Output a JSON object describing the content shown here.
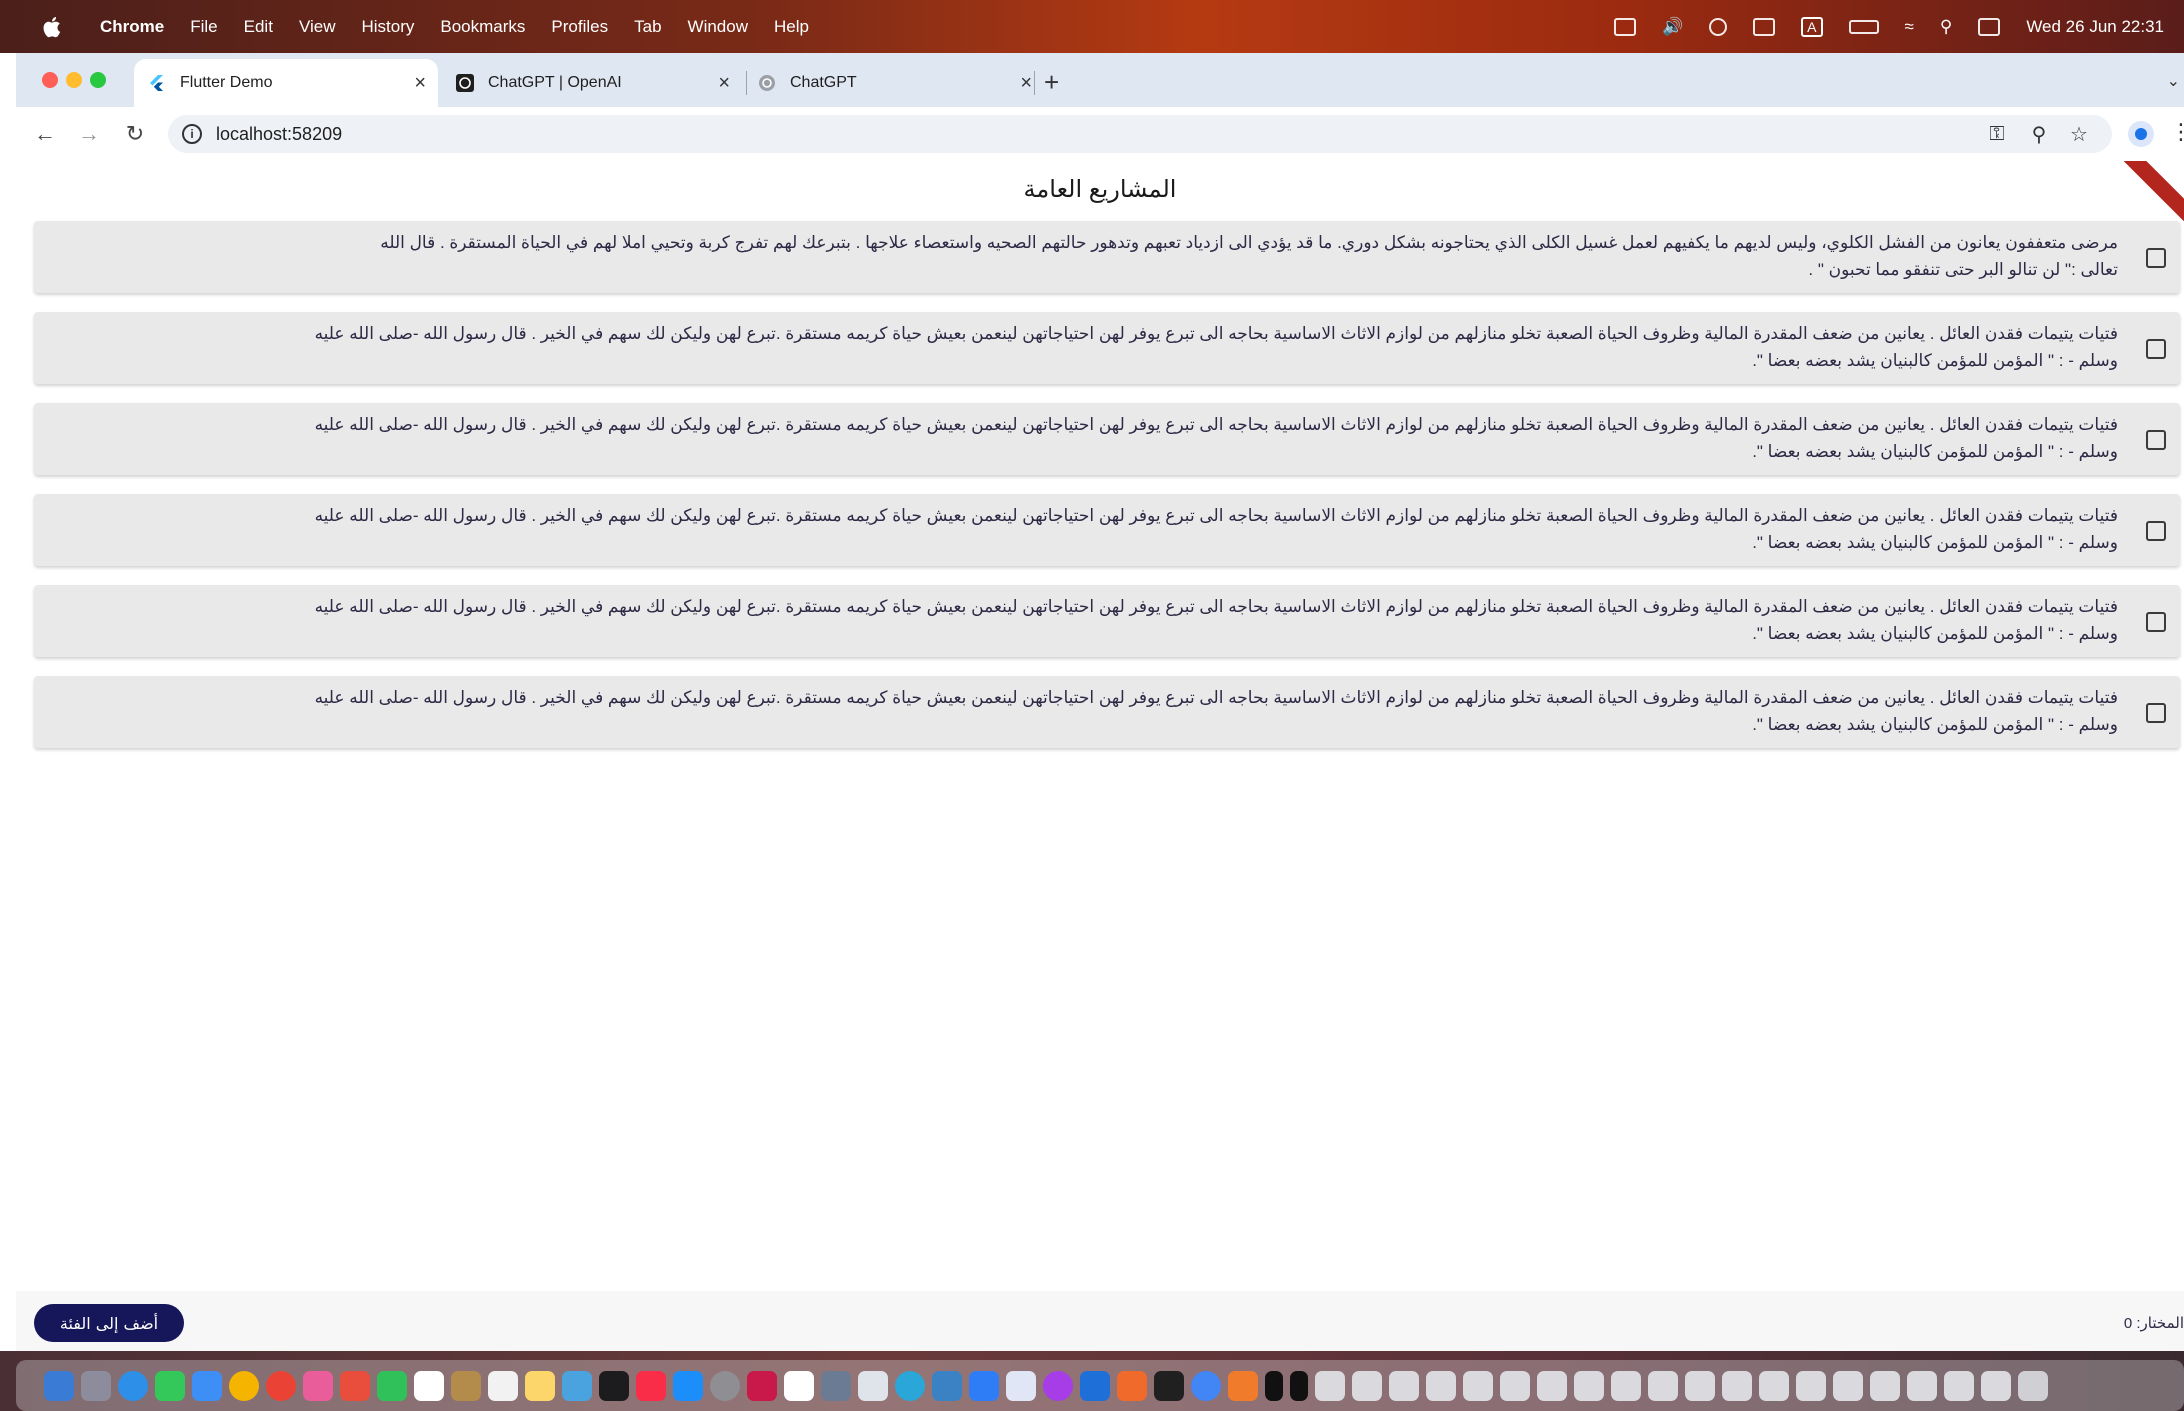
{
  "menubar": {
    "app": "Chrome",
    "items": [
      "File",
      "Edit",
      "View",
      "History",
      "Bookmarks",
      "Profiles",
      "Tab",
      "Window",
      "Help"
    ],
    "datetime": "Wed 26 Jun  22:31",
    "input_indicator": "A"
  },
  "tabs": [
    {
      "title": "Flutter Demo",
      "icon": "flutter-icon",
      "active": true
    },
    {
      "title": "ChatGPT | OpenAI",
      "icon": "openai-icon",
      "active": false
    },
    {
      "title": "ChatGPT",
      "icon": "openai-icon",
      "active": false
    }
  ],
  "address": {
    "url": "localhost:58209"
  },
  "page": {
    "title": "المشاريع العامة",
    "projects": [
      {
        "line1": "مرضى متعففون يعانون من الفشل الكلوي، وليس لديهم ما يكفيهم لعمل غسيل الكلى الذي يحتاجونه بشكل دوري. ما قد يؤدي الى ازدياد تعبهم وتدهور حالتهم الصحيه واستعصاء علاجها . بتبرعك لهم تفرج كربة وتحيي املا لهم في الحياة المستقرة . قال الله",
        "line2": "تعالى :\" لن تنالو البر حتى تنفقو مما تحبون \" ."
      },
      {
        "line1": "فتيات يتيمات فقدن العائل . يعانين من ضعف المقدرة المالية وظروف الحياة الصعبة تخلو منازلهم من لوازم الاثاث الاساسية بحاجه الى تبرع يوفر لهن احتياجاتهن لينعمن بعيش حياة كريمه مستقرة .تبرع لهن وليكن لك سهم في الخير . قال رسول  الله -صلى الله عليه",
        "line2": "وسلم - : \" المؤمن للمؤمن كالبنيان يشد بعضه بعضا \"."
      },
      {
        "line1": "فتيات يتيمات فقدن العائل . يعانين من ضعف المقدرة المالية وظروف الحياة الصعبة تخلو منازلهم من لوازم الاثاث الاساسية بحاجه الى تبرع يوفر لهن احتياجاتهن لينعمن بعيش حياة كريمه مستقرة .تبرع لهن وليكن لك سهم في الخير . قال رسول  الله -صلى الله عليه",
        "line2": "وسلم - : \" المؤمن للمؤمن كالبنيان يشد بعضه بعضا \"."
      },
      {
        "line1": "فتيات يتيمات فقدن العائل . يعانين من ضعف المقدرة المالية وظروف الحياة الصعبة تخلو منازلهم من لوازم الاثاث الاساسية بحاجه الى تبرع يوفر لهن احتياجاتهن لينعمن بعيش حياة كريمه مستقرة .تبرع لهن وليكن لك سهم في الخير . قال رسول  الله -صلى الله عليه",
        "line2": "وسلم - : \" المؤمن للمؤمن كالبنيان يشد بعضه بعضا \"."
      },
      {
        "line1": "فتيات يتيمات فقدن العائل . يعانين من ضعف المقدرة المالية وظروف الحياة الصعبة تخلو منازلهم من لوازم الاثاث الاساسية بحاجه الى تبرع يوفر لهن احتياجاتهن لينعمن بعيش حياة كريمه مستقرة .تبرع لهن وليكن لك سهم في الخير . قال رسول  الله -صلى الله عليه",
        "line2": "وسلم - : \" المؤمن للمؤمن كالبنيان يشد بعضه بعضا \"."
      },
      {
        "line1": "فتيات يتيمات فقدن العائل . يعانين من ضعف المقدرة المالية وظروف الحياة الصعبة تخلو منازلهم من لوازم الاثاث الاساسية بحاجه الى تبرع يوفر لهن احتياجاتهن لينعمن بعيش حياة كريمه مستقرة .تبرع لهن وليكن لك سهم في الخير . قال رسول  الله -صلى الله عليه",
        "line2": "وسلم - : \" المؤمن للمؤمن كالبنيان يشد بعضه بعضا \"."
      }
    ],
    "add_button": "أضف إلى الفئة",
    "selected_label": "المختار: 0"
  },
  "colors": {
    "primary_button": "#16165a",
    "card_bg": "#e9e9ea",
    "text": "#2d2a45",
    "tabstrip": "#dfe7f3"
  }
}
